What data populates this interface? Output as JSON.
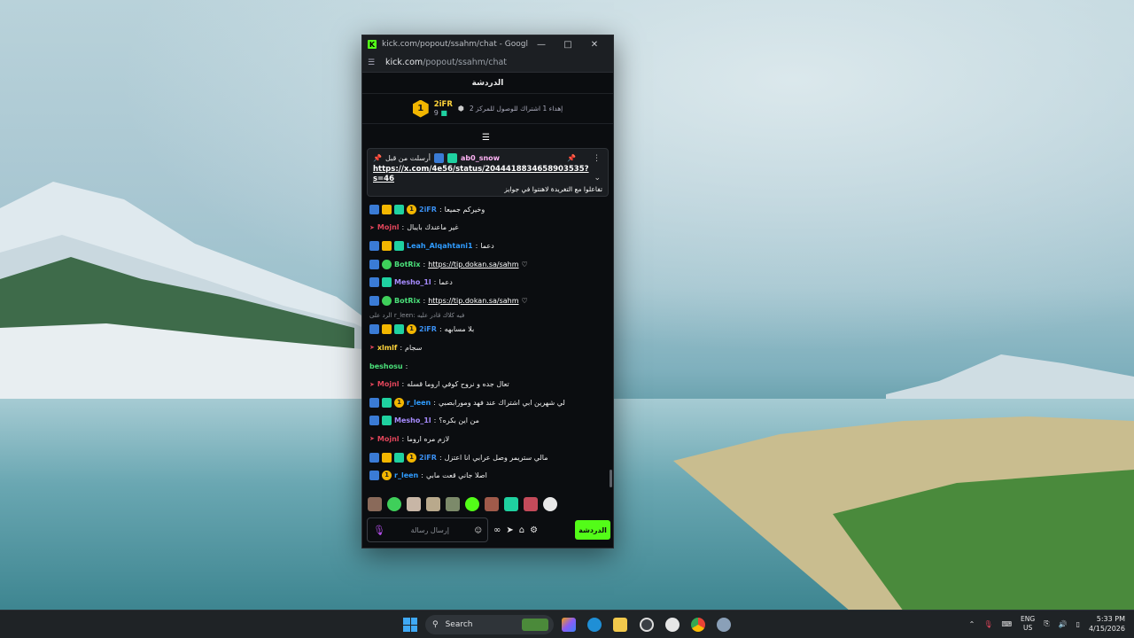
{
  "window": {
    "title": "kick.com/popout/ssahm/chat - Google Chrome",
    "url_host": "kick.com",
    "url_path": "/popout/ssahm/chat"
  },
  "chat": {
    "header": "الدردشة",
    "leaderboard": {
      "rank": "1",
      "user": "2iFR",
      "count": "9",
      "goal_text": "إهداء 1 اشتراك للوصول للمركز 2"
    },
    "pinned": {
      "label": "أرسلت من قبل",
      "user": "ab0_snow",
      "link": "https://x.com/4e56/status/2044418834658903535?s=46",
      "message": "تفاعلوا مع التغريدة لاهنتوا في جوايز"
    },
    "messages": [
      {
        "user": "2iFR",
        "user_color": "#3a8ff0",
        "text": "وخيركم جميعا",
        "badges": [
          "blue",
          "crown",
          "green",
          "gold"
        ]
      },
      {
        "user": "Mojnl",
        "user_color": "#e0455a",
        "text": "غير ماعندك بايبال",
        "badges": [
          "red"
        ]
      },
      {
        "user": "Leah_Alqahtani1",
        "user_color": "#2f9cff",
        "text": "دعما",
        "badges": [
          "blue",
          "crown",
          "green"
        ]
      },
      {
        "user": "BotRix",
        "user_color": "#4be07a",
        "text": "https://tip.dokan.sa/sahm",
        "link": true,
        "badges": [
          "blue",
          "verified"
        ]
      },
      {
        "user": "Mesho_1l",
        "user_color": "#a68bff",
        "text": "دعما",
        "badges": [
          "blue",
          "green"
        ]
      },
      {
        "user": "BotRix",
        "user_color": "#4be07a",
        "text": "https://tip.dokan.sa/sahm",
        "link": true,
        "badges": [
          "blue",
          "verified"
        ]
      },
      {
        "reply": "الرد على r_leen: فيه كلاك قادر عليه"
      },
      {
        "user": "2iFR",
        "user_color": "#3a8ff0",
        "text": "بلا مسابهه",
        "badges": [
          "blue",
          "crown",
          "green",
          "gold"
        ]
      },
      {
        "user": "xlmlf",
        "user_color": "#ffd43b",
        "text": "سجام",
        "badges": [
          "red"
        ]
      },
      {
        "user": "beshosu",
        "user_color": "#4be07a",
        "text": "",
        "badges": []
      },
      {
        "user": "Mojnl",
        "user_color": "#e0455a",
        "text": "تعال جده و نروح كوفي اروما قسله",
        "badges": [
          "red"
        ]
      },
      {
        "user": "r_leen",
        "user_color": "#2f9cff",
        "text": "لي شهرين ابي اشتراك عند فهد ومورابصبي",
        "badges": [
          "blue",
          "green",
          "gold"
        ]
      },
      {
        "user": "Mesho_1l",
        "user_color": "#a68bff",
        "text": "من اين بكره؟",
        "badges": [
          "blue",
          "green"
        ]
      },
      {
        "user": "Mojnl",
        "user_color": "#e0455a",
        "text": "لازم مره اروما",
        "badges": [
          "red"
        ]
      },
      {
        "user": "2iFR",
        "user_color": "#3a8ff0",
        "text": "مالي ستريمر وصل عرابي انا اعتزل",
        "badges": [
          "blue",
          "crown",
          "green",
          "gold"
        ]
      },
      {
        "user": "r_leen",
        "user_color": "#2f9cff",
        "text": "اصلا جاني قعت مابي",
        "badges": [
          "blue",
          "gold"
        ]
      }
    ],
    "input_placeholder": "إرسال رسالة",
    "send_label": "الدردشة"
  },
  "taskbar": {
    "search_label": "Search",
    "lang_top": "ENG",
    "lang_bottom": "US",
    "time": "5:33 PM",
    "date": "4/15/2026"
  }
}
